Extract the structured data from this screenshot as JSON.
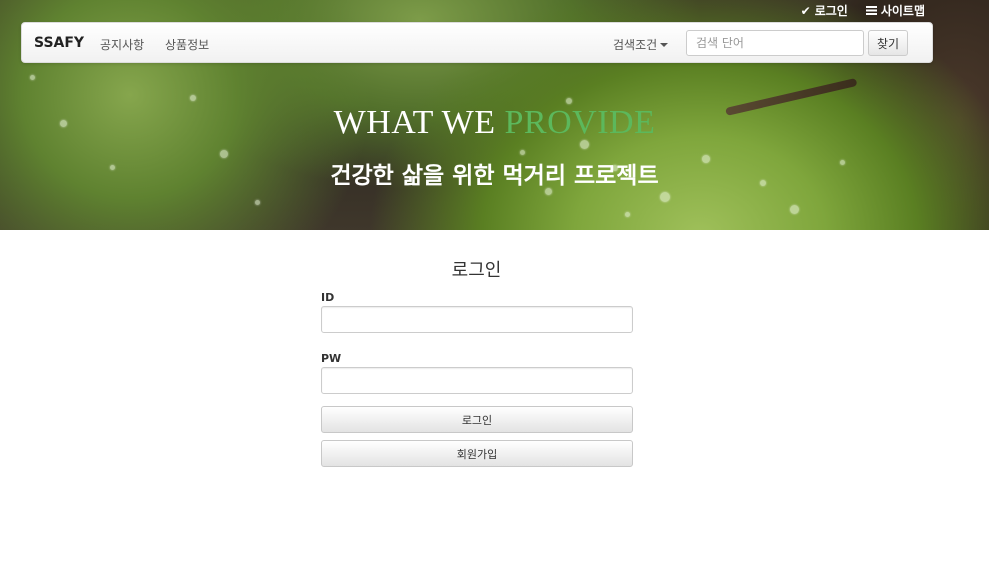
{
  "utility": {
    "login_label": "로그인",
    "sitemap_label": "사이트맵"
  },
  "navbar": {
    "brand": "SSAFY",
    "links": [
      "공지사항",
      "상품정보"
    ],
    "search_condition": "검색조건",
    "search_placeholder": "검색 단어",
    "search_button": "찾기"
  },
  "hero": {
    "title_main": "WHAT WE ",
    "title_accent": "PROVIDE",
    "subtitle": "건강한 삶을 위한 먹거리 프로젝트",
    "accent_color": "#5cb85c"
  },
  "login": {
    "title": "로그인",
    "id_label": "ID",
    "pw_label": "PW",
    "login_button": "로그인",
    "signup_button": "회원가입"
  },
  "icons": [
    "check-icon",
    "list-icon",
    "caret-down-icon"
  ]
}
